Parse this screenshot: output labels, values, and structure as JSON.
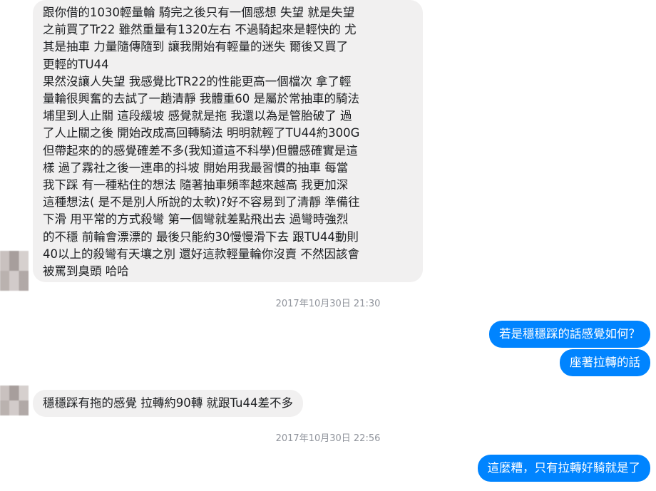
{
  "conversation": {
    "messages": [
      {
        "direction": "incoming",
        "lines": [
          "跟你借的1030輕量輪 騎完之後只有一個感想  失望 就是失望",
          "之前買了Tr22 雖然重量有1320左右 不過騎起來是輕快的 尤",
          "其是抽車 力量隨傳隨到 讓我開始有輕量的迷失 爾後又買了",
          "更輕的TU44",
          "果然沒讓人失望 我感覺比TR22的性能更高一個檔次  拿了輕",
          "量輪很興奮的去試了一趟清靜 我體重60 是屬於常抽車的騎法",
          "埔里到人止關 這段緩坡 感覺就是拖 我還以為是管胎破了  過",
          "了人止關之後 開始改成高回轉騎法 明明就輕了TU44約300G",
          "但帶起來的的感覺確差不多(我知道這不科學)但體感確實是這",
          "樣 過了霧社之後一連串的抖坡 開始用我最習慣的抽車 每當",
          "我下踩 有一種粘住的想法 隨著抽車頻率越來越高 我更加深",
          "這種想法( 是不是別人所說的太軟)?好不容易到了清靜 準備往",
          "下滑 用平常的方式殺彎 第一個彎就差點飛出去 過彎時強烈",
          "的不穩 前輪會漂漂的 最後只能約30慢慢滑下去 跟TU44動則",
          "40以上的殺彎有天壤之別 還好這款輕量輪你沒賣 不然因該會",
          "被罵到臭頭  哈哈"
        ]
      },
      {
        "timestamp": "2017年10月30日 21:30"
      },
      {
        "direction": "outgoing",
        "text": "若是穩穩踩的話感覺如何？"
      },
      {
        "direction": "outgoing",
        "text": "座著拉轉的話"
      },
      {
        "direction": "incoming",
        "text": "穩穩踩有拖的感覺 拉轉約90轉 就跟Tu44差不多"
      },
      {
        "timestamp": "2017年10月30日 22:56"
      },
      {
        "direction": "outgoing",
        "text": "這麼糟，只有拉轉好騎就是了"
      }
    ]
  }
}
